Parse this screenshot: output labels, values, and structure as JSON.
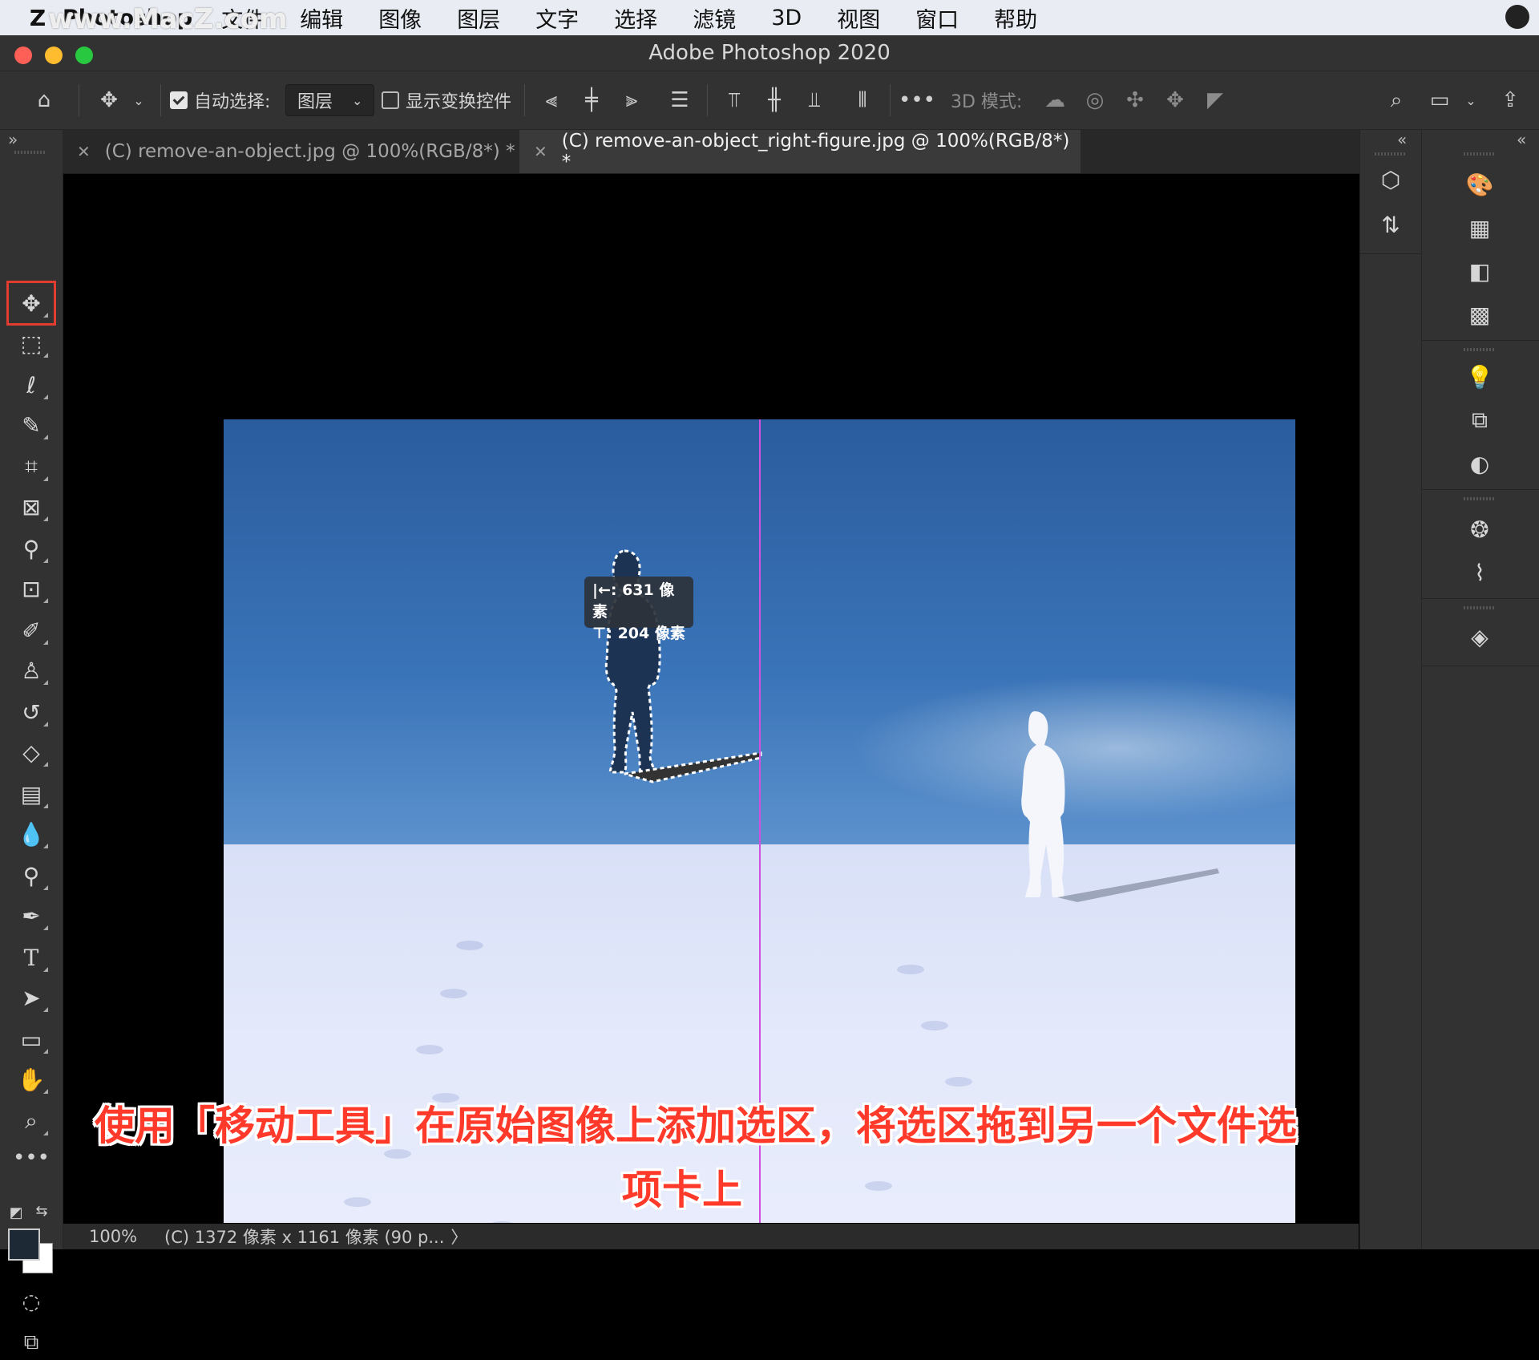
{
  "watermark": "www.MacZ.com",
  "menubar": {
    "app_name": "Photoshop",
    "items": [
      "文件",
      "编辑",
      "图像",
      "图层",
      "文字",
      "选择",
      "滤镜",
      "3D",
      "视图",
      "窗口",
      "帮助"
    ]
  },
  "window": {
    "title": "Adobe Photoshop 2020"
  },
  "options_bar": {
    "auto_select_label": "自动选择:",
    "auto_select_checked": true,
    "auto_select_target": "图层",
    "show_transform_label": "显示变换控件",
    "show_transform_checked": false,
    "mode_3d_label": "3D 模式:"
  },
  "tabs": [
    {
      "label": "(C) remove-an-object.jpg @ 100%(RGB/8*) *",
      "active": false
    },
    {
      "label": "(C) remove-an-object_right-figure.jpg @ 100%(RGB/8*) *",
      "active": true
    }
  ],
  "canvas": {
    "tooltip_x_label": "|←: 631 像素",
    "tooltip_y_label": "⊤: 204 像素"
  },
  "status": {
    "zoom": "100%",
    "doc_info": "(C) 1372 像素 x 1161 像素 (90 p...",
    "arrow": "〉"
  },
  "caption": {
    "line1": "使用「移动工具」在原始图像上添加选区，将选区拖到另一个文件选",
    "line2": "项卡上"
  },
  "tools": [
    "move-tool-icon",
    "marquee-tool-icon",
    "lasso-tool-icon",
    "quick-select-tool-icon",
    "crop-tool-icon",
    "frame-tool-icon",
    "eyedropper-tool-icon",
    "healing-brush-tool-icon",
    "brush-tool-icon",
    "clone-stamp-tool-icon",
    "history-brush-tool-icon",
    "eraser-tool-icon",
    "gradient-tool-icon",
    "blur-tool-icon",
    "dodge-tool-icon",
    "pen-tool-icon",
    "type-tool-icon",
    "path-select-tool-icon",
    "rectangle-tool-icon",
    "hand-tool-icon",
    "zoom-tool-icon",
    "more-tools-icon"
  ]
}
